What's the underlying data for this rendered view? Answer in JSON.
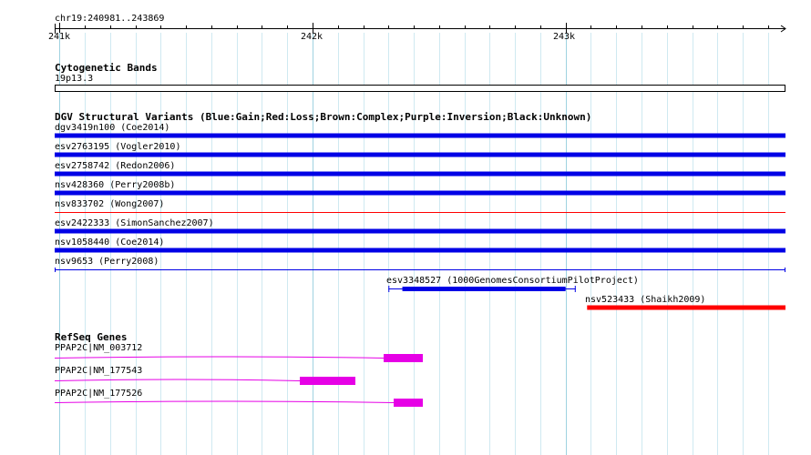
{
  "ruler": {
    "region": "chr19:240981..243869",
    "ticks": [
      {
        "pos": 241000,
        "label": "241k"
      },
      {
        "pos": 242000,
        "label": "242k"
      },
      {
        "pos": 243000,
        "label": "243k"
      }
    ]
  },
  "cytoband": {
    "title": "Cytogenetic Bands",
    "band": "19p13.3"
  },
  "dgv": {
    "title": "DGV Structural Variants (Blue:Gain;Red:Loss;Brown:Complex;Purple:Inversion;Black:Unknown)",
    "colors": {
      "gain": "#0000e6",
      "loss": "#ff0000"
    },
    "variants": [
      {
        "label": "dgv3419n100 (Coe2014)",
        "type": "gain",
        "style": "thick"
      },
      {
        "label": "esv2763195 (Vogler2010)",
        "type": "gain",
        "style": "thick"
      },
      {
        "label": "esv2758742 (Redon2006)",
        "type": "gain",
        "style": "thick"
      },
      {
        "label": "nsv428360 (Perry2008b)",
        "type": "gain",
        "style": "thick"
      },
      {
        "label": "nsv833702 (Wong2007)",
        "type": "loss",
        "style": "thin"
      },
      {
        "label": "esv2422333 (SimonSanchez2007)",
        "type": "gain",
        "style": "thick"
      },
      {
        "label": "nsv1058440 (Coe2014)",
        "type": "gain",
        "style": "thick"
      },
      {
        "label": "nsv9653 (Perry2008)",
        "type": "gain",
        "style": "thin"
      },
      {
        "label": "esv3348527 (1000GenomesConsortiumPilotProject)",
        "type": "gain",
        "style": "partial"
      },
      {
        "label": "nsv523433 (Shaikh2009)",
        "type": "loss",
        "style": "partial"
      }
    ]
  },
  "refseq": {
    "title": "RefSeq Genes",
    "color": "#e600e6",
    "genes": [
      {
        "label": "PPAP2C|NM_003712"
      },
      {
        "label": "PPAP2C|NM_177543"
      },
      {
        "label": "PPAP2C|NM_177526"
      }
    ]
  }
}
